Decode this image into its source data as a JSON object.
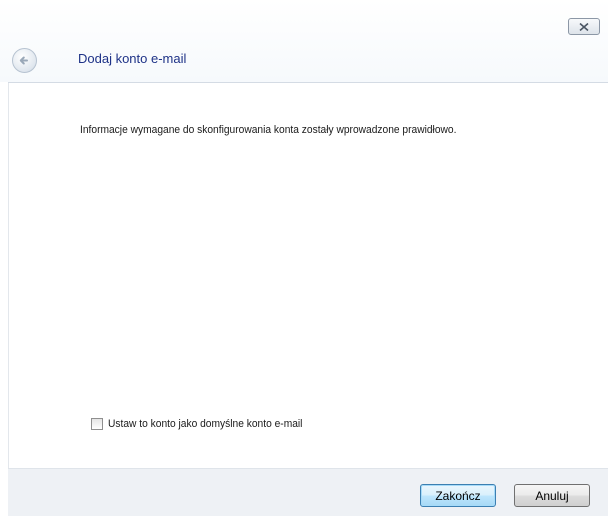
{
  "window": {
    "title": "Dodaj konto e-mail",
    "close_glyph": "✕"
  },
  "icons": {
    "back": "back-arrow-icon",
    "close": "close-icon"
  },
  "content": {
    "info_text": "Informacje wymagane do skonfigurowania konta zostały wprowadzone prawidłowo.",
    "default_account_checkbox": {
      "label": "Ustaw to konto jako domyślne konto e-mail",
      "checked": false
    }
  },
  "footer": {
    "finish_label": "Zakończ",
    "cancel_label": "Anuluj"
  },
  "colors": {
    "title": "#1e3287",
    "footer_bg": "#eef1f5",
    "default_button_border": "#3c7fb1"
  }
}
